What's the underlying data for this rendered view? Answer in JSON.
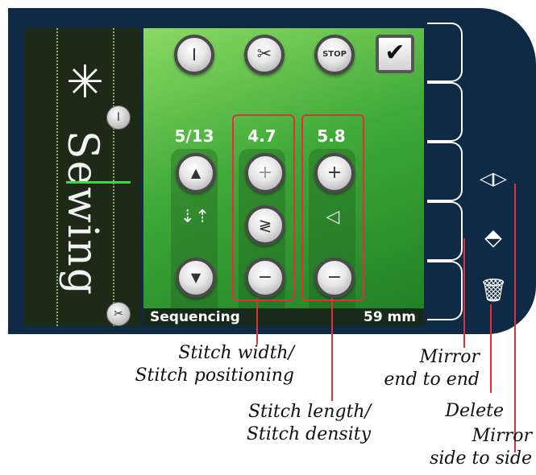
{
  "left_panel": {
    "sequence_text": "Sewing",
    "top_icon": "I",
    "bottom_icon": "✂"
  },
  "top_buttons": [
    {
      "name": "needle-up-icon",
      "symbol": "I"
    },
    {
      "name": "scissors-icon",
      "symbol": "✂"
    },
    {
      "name": "stop-icon",
      "symbol": "STOP"
    }
  ],
  "checkbox_symbol": "✔",
  "columns": {
    "position": {
      "value": "5/13",
      "up": "▲",
      "mid": "⇣⇡",
      "down": "▼"
    },
    "width": {
      "value": "4.7",
      "up": "+",
      "mid": "≷",
      "down": "−"
    },
    "length": {
      "value": "5.8",
      "up": "+",
      "mid": "◁",
      "down": "−"
    }
  },
  "status_bar": {
    "title": "Sequencing",
    "length": "59 mm"
  },
  "side_icons": {
    "mirror_side": "◁▷",
    "mirror_end": "⬘",
    "delete": "🗑"
  },
  "callouts": {
    "width": "Stitch width/\nStitch positioning",
    "length": "Stitch length/\nStitch density",
    "mirror_end": "Mirror\nend to end",
    "delete": "Delete",
    "mirror_side": "Mirror\nside to side"
  },
  "colors": {
    "accent_red": "#e1303b",
    "panel_navy": "#0f2a44",
    "green": "#3fa938"
  }
}
